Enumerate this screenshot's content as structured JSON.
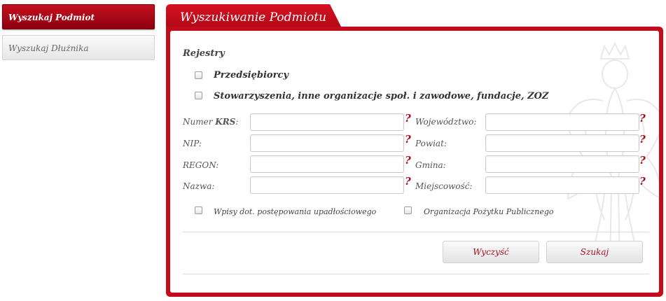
{
  "sidebar": {
    "items": [
      {
        "label": "Wyszukaj Podmiot",
        "active": true
      },
      {
        "label": "Wyszukaj Dłużnika",
        "active": false
      }
    ]
  },
  "panel": {
    "title": "Wyszukiwanie Podmiotu",
    "registers_heading": "Rejestry",
    "registers": [
      {
        "label": "Przedsiębiorcy",
        "checked": false
      },
      {
        "label": "Stowarzyszenia, inne organizacje społ. i zawodowe, fundacje, ZOZ",
        "checked": false
      }
    ],
    "fields_left": [
      {
        "label_prefix": "Numer ",
        "label_bold": "KRS",
        "label_suffix": ":",
        "value": "",
        "help": "?"
      },
      {
        "label_prefix": "NIP:",
        "label_bold": "",
        "label_suffix": "",
        "value": "",
        "help": "?"
      },
      {
        "label_prefix": "REGON:",
        "label_bold": "",
        "label_suffix": "",
        "value": "",
        "help": "?"
      },
      {
        "label_prefix": "Nazwa:",
        "label_bold": "",
        "label_suffix": "",
        "value": "",
        "help": "?"
      }
    ],
    "fields_right": [
      {
        "label": "Województwo:",
        "value": "",
        "help": "?"
      },
      {
        "label": "Powiat:",
        "value": "",
        "help": "?"
      },
      {
        "label": "Gmina:",
        "value": "",
        "help": "?"
      },
      {
        "label": "Miejscowość:",
        "value": "",
        "help": "?"
      }
    ],
    "options": [
      {
        "label": "Wpisy dot. postępowania upadłościowego",
        "checked": false
      },
      {
        "label": "Organizacja Pożytku Publicznego",
        "checked": false
      }
    ],
    "buttons": {
      "clear": "Wyczyść",
      "search": "Szukaj"
    }
  },
  "colors": {
    "brand_red": "#c20b1b",
    "help_mark": "#a5101e"
  }
}
